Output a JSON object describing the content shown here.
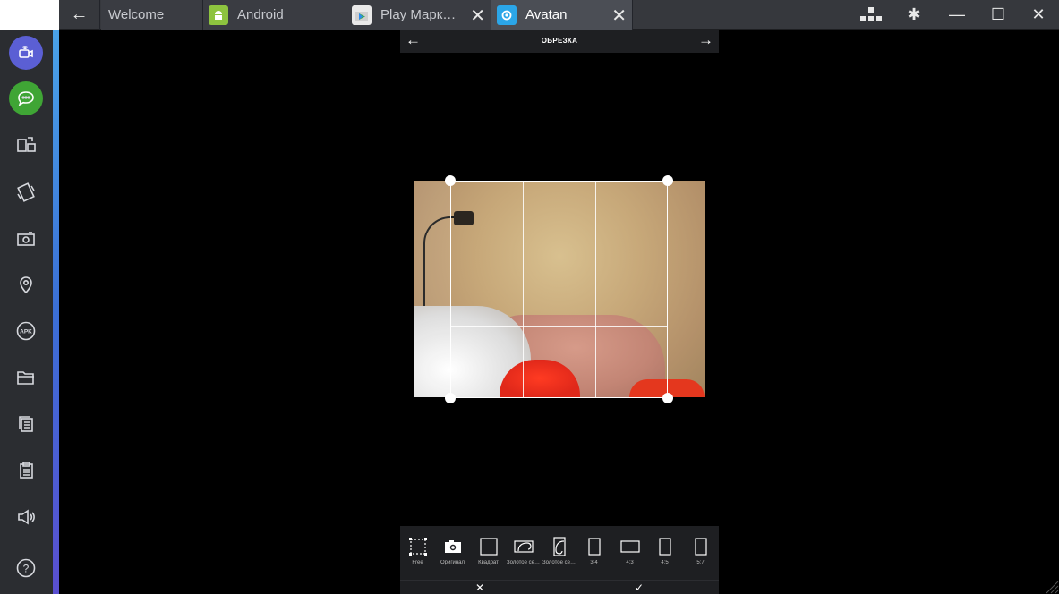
{
  "tabs": [
    {
      "label": "Welcome",
      "icon": "welcome-icon"
    },
    {
      "label": "Android",
      "icon": "android-icon",
      "color": "#8dc33f"
    },
    {
      "label": "Play Марк…",
      "icon": "play-store-icon"
    },
    {
      "label": "Avatan",
      "icon": "avatan-icon",
      "color": "#2ba6e8",
      "active": true
    }
  ],
  "window_controls": [
    "keymap-icon",
    "gear-icon",
    "minimize-icon",
    "maximize-icon",
    "close-icon"
  ],
  "sidebar": {
    "items": [
      {
        "icon": "video-call-icon",
        "color": "#5b5fd4"
      },
      {
        "icon": "chat-icon",
        "color": "#3fa535"
      },
      {
        "icon": "rotate-screen-icon"
      },
      {
        "icon": "shake-icon"
      },
      {
        "icon": "camera-icon"
      },
      {
        "icon": "location-icon"
      },
      {
        "icon": "apk-icon",
        "label": "APK"
      },
      {
        "icon": "folder-icon"
      },
      {
        "icon": "copy-icon"
      },
      {
        "icon": "paste-icon"
      },
      {
        "icon": "volume-icon"
      },
      {
        "icon": "help-icon",
        "label": "?"
      }
    ]
  },
  "app": {
    "title": "ОБРЕЗКА",
    "back_glyph": "←",
    "next_glyph": "→",
    "tools": [
      {
        "label": "Free",
        "icon": "free-crop-icon"
      },
      {
        "label": "Оригинал",
        "icon": "original-icon"
      },
      {
        "label": "Квадрат",
        "icon": "square-icon"
      },
      {
        "label": "Золотое се…",
        "icon": "golden-ratio-landscape-icon"
      },
      {
        "label": "Золотое се…",
        "icon": "golden-ratio-portrait-icon"
      },
      {
        "label": "3:4",
        "icon": "ratio-3-4-icon"
      },
      {
        "label": "4:3",
        "icon": "ratio-4-3-icon"
      },
      {
        "label": "4:5",
        "icon": "ratio-4-5-icon"
      },
      {
        "label": "5:7",
        "icon": "ratio-5-7-icon"
      }
    ],
    "cancel_glyph": "✕",
    "confirm_glyph": "✓"
  },
  "glyphs": {
    "back": "←",
    "tab_close": "✕",
    "minimize": "—",
    "maximize": "☐",
    "close": "✕",
    "gear": "✱"
  }
}
